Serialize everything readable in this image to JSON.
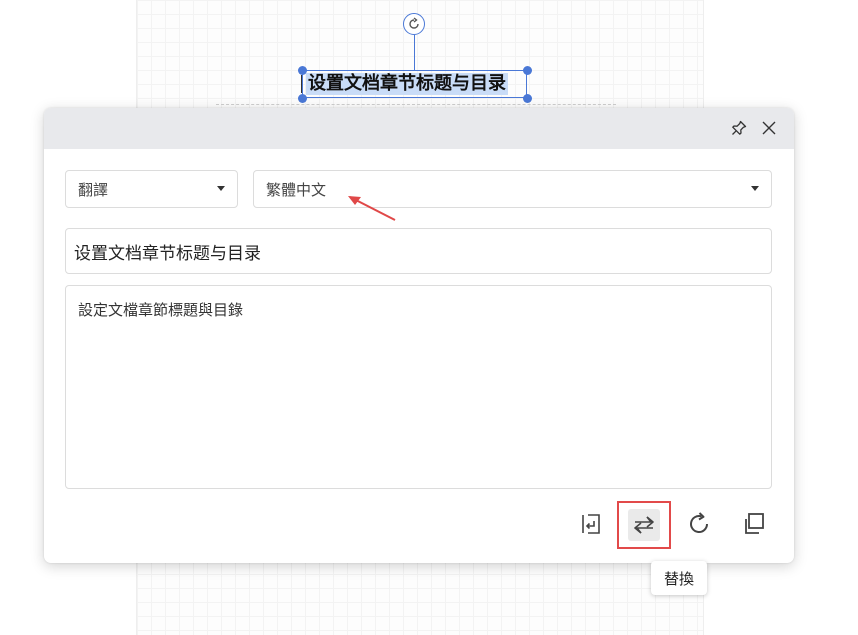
{
  "canvas": {
    "selected_heading": "设置文档章节标题与目录"
  },
  "panel": {
    "mode_select": {
      "value": "翻譯"
    },
    "language_select": {
      "value": "繁體中文"
    },
    "source_text": "设置文档章节标题与目录",
    "result_text": "設定文檔章節標題與目錄",
    "header_icons": [
      "pin-icon",
      "close-icon"
    ],
    "actions": [
      {
        "name": "insert-below-button",
        "icon": "insert-icon"
      },
      {
        "name": "replace-button",
        "icon": "replace-icon",
        "active": true
      },
      {
        "name": "retranslate-button",
        "icon": "refresh-icon"
      },
      {
        "name": "copy-button",
        "icon": "copy-icon"
      }
    ]
  },
  "tooltip": {
    "text": "替換"
  },
  "colors": {
    "selection": "#4a78d6",
    "highlight_border": "#e24a4a",
    "header_bg": "#e8e9ec",
    "annotation_arrow": "#e04848"
  }
}
